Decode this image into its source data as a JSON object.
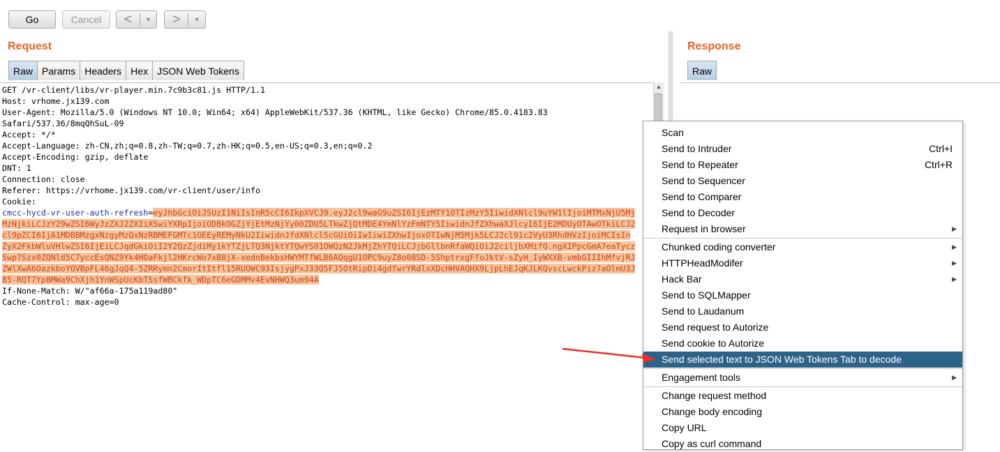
{
  "toolbar": {
    "go_label": "Go",
    "cancel_label": "Cancel",
    "back_glyph": "<",
    "forward_glyph": ">",
    "dropdown_glyph": "▼"
  },
  "request": {
    "title": "Request",
    "tabs": [
      "Raw",
      "Params",
      "Headers",
      "Hex",
      "JSON Web Tokens"
    ],
    "active_tab": "Raw",
    "lines_before": [
      "GET /vr-client/libs/vr-player.min.7c9b3c81.js HTTP/1.1",
      "Host: vrhome.jx139.com",
      "User-Agent: Mozilla/5.0 (Windows NT 10.0; Win64; x64) AppleWebKit/537.36 (KHTML, like Gecko) Chrome/85.0.4183.83",
      "Safari/537.36/8mqQhSuL-09",
      "Accept: */*",
      "Accept-Language: zh-CN,zh;q=0.8,zh-TW;q=0.7,zh-HK;q=0.5,en-US;q=0.3,en;q=0.2",
      "Accept-Encoding: gzip, deflate",
      "DNT: 1",
      "Connection: close",
      "Referer: https://vrhome.jx139.com/vr-client/user/info",
      "Cookie:"
    ],
    "cookie_name": "cmcc-hycd-vr-user-auth-refresh",
    "cookie_eq": "=",
    "cookie_value_lines": [
      "eyJhbGciOiJSUzI1NiIsInR5cCI6IkpXVCJ9.eyJ2cl9waG9uZSI6IjEzMTY1OTIzMzY5IiwidXNlcl9uYW1lIjoiMTMxNjU5Mj",
      "MzNjkiLCJzY29wZSI6WyJzZXJ2ZXIiXSwiYXRpIjoiODBkOGZjYjEtMzNjYy00ZDU5LTkwZjQtMDE4YmNlYzFmNTY5IiwidnJfZXhwaXJlcyI6IjE2MDUyOTAwOTkiLCJ2",
      "cl9pZCI6IjA1MDBBMzgxNzgyMzQxNzRBMEFGMTc1OEEyREMyNkU2IiwidnJfdXNlcl5cGUiOiIwIiwiZXhwIjoxOTIwNjM5Mjk5LCJ2cl91c2VyU3RhdHVzIjoiMCIsIn",
      "ZyX2FkbWluVHlwZSI6IjEiLCJqdGkiOiI2Y2QzZjdiMy1kYTZjLTQ3NjktYTQwYS01OWQzN2JkMjZhYTQiLCJjbGllbnRfaWQiOiJ2ciljbXMifQ.ngXIPpcGmA7eaTycz",
      "Swp7Szx0ZQNld5C7yccEsQNZ9Yk4HOaFkjl2HKrcWo7xB8jX-xednBekbsHWYMTfWLB6AQqgU1OPC9uyZ8o08SD-5ShptrxgFfoJktV-sZyH_IyWXXB-vmbGIIIhMfvjRJ",
      "ZWlXwA6OazkboYOVBpFL46gJqQ4-5ZRRymn2CmorItItfl15RUOWC93IsjygPxJ33Q5FJ5OtRipDi4gdfwrYRdlxXDcHHVAQHX9LjpLhEJqKJLKQvscLwckPiz7aOlmU3J",
      "85-RQT7Yp8MWa9ChXjh1YnWSpUcKbTSsfWBCkfk_WDpTC6eGDMMv4EvNHWQ3um94A"
    ],
    "lines_after": [
      "If-None-Match: W/\"af66a-175a119ad80\"",
      "Cache-Control: max-age=0"
    ]
  },
  "response": {
    "title": "Response",
    "tabs": [
      "Raw"
    ],
    "active_tab": "Raw"
  },
  "context_menu": {
    "groups": [
      [
        {
          "label": "Scan"
        },
        {
          "label": "Send to Intruder",
          "shortcut": "Ctrl+I"
        },
        {
          "label": "Send to Repeater",
          "shortcut": "Ctrl+R"
        },
        {
          "label": "Send to Sequencer"
        },
        {
          "label": "Send to Comparer"
        },
        {
          "label": "Send to Decoder"
        },
        {
          "label": "Request in browser",
          "submenu": true
        }
      ],
      [
        {
          "label": "Chunked coding converter",
          "submenu": true
        },
        {
          "label": "HTTPHeadModifer",
          "submenu": true
        },
        {
          "label": "Hack Bar",
          "submenu": true
        },
        {
          "label": "Send to SQLMapper"
        },
        {
          "label": "Send to Laudanum"
        },
        {
          "label": "Send request to Autorize"
        },
        {
          "label": "Send cookie to Autorize"
        },
        {
          "label": "Send selected text to JSON Web Tokens Tab to decode",
          "selected": true
        }
      ],
      [
        {
          "label": "Engagement tools",
          "submenu": true
        }
      ],
      [
        {
          "label": "Change request method"
        },
        {
          "label": "Change body encoding"
        },
        {
          "label": "Copy URL"
        },
        {
          "label": "Copy as curl command"
        }
      ]
    ],
    "submenu_glyph": "▶"
  },
  "colors": {
    "section_title": "#e8632a",
    "highlight_bg": "#f9c39a",
    "highlight_text": "#c8431b",
    "menu_selected": "#2e6389",
    "annotation_arrow": "#e8312a"
  }
}
